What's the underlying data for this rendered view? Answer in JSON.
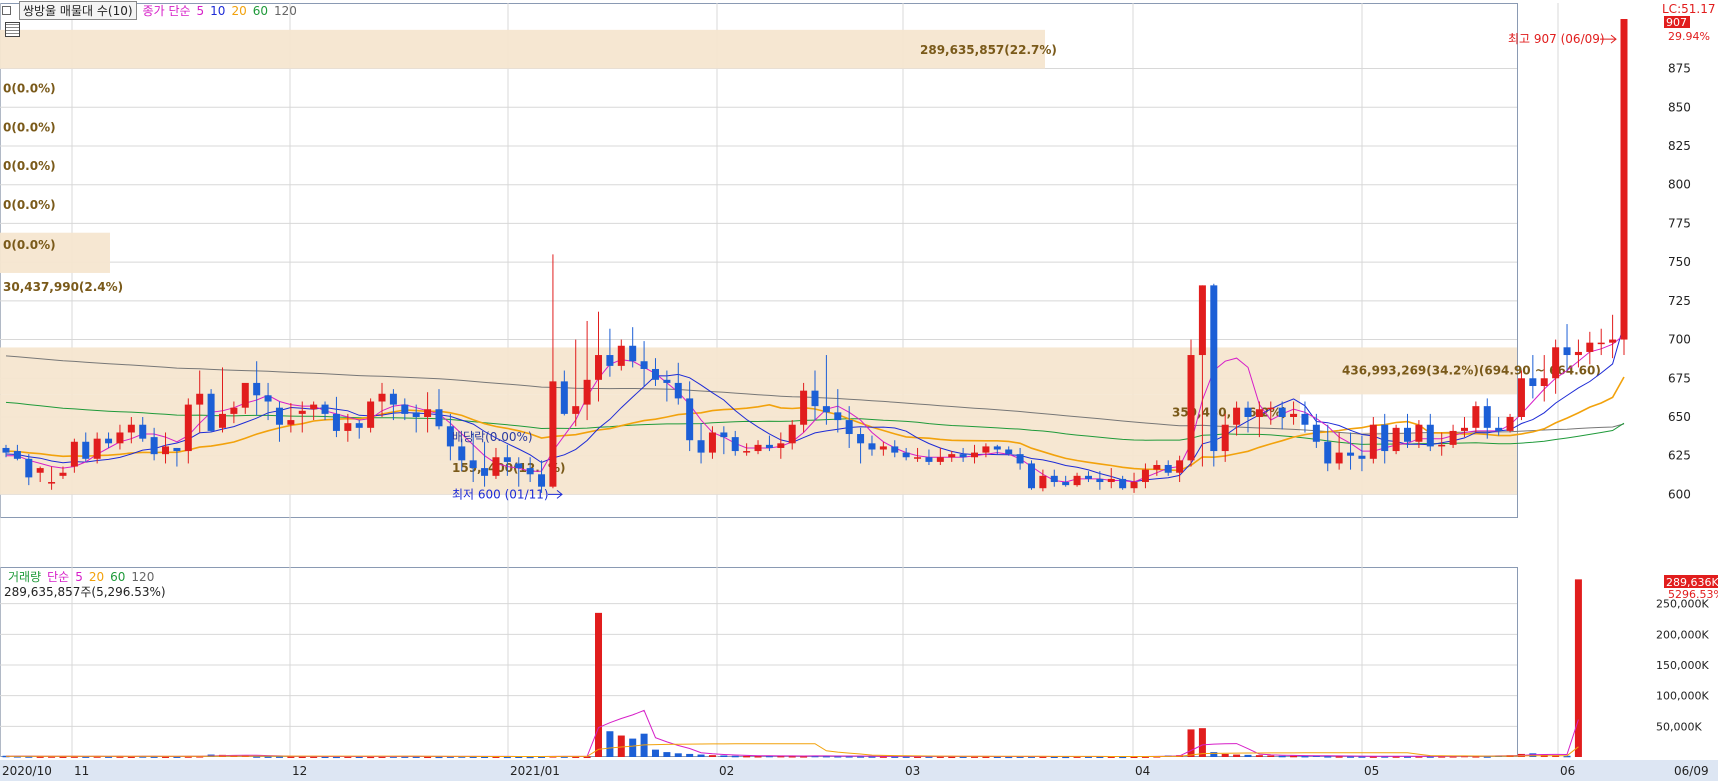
{
  "legend": {
    "title": "쌍방울 매물대 수(10)",
    "ma_label": "종가 단순",
    "ma": [
      {
        "label": "5",
        "color": "#d61fc8"
      },
      {
        "label": "10",
        "color": "#1d2bd6"
      },
      {
        "label": "20",
        "color": "#f2a20c"
      },
      {
        "label": "60",
        "color": "#1f9a3a"
      },
      {
        "label": "120",
        "color": "#666666"
      }
    ]
  },
  "header_right": {
    "lc": "LC:51.17",
    "price": "907",
    "pct": "29.94%"
  },
  "price_axis": {
    "ticks": [
      600,
      625,
      650,
      675,
      700,
      725,
      750,
      775,
      800,
      825,
      850,
      875
    ],
    "min": 588,
    "max": 907
  },
  "annotations": {
    "high": "최고 907 (06/09)",
    "low": "최저 600 (01/11)",
    "ex_div": "배당락(0.00%)"
  },
  "profile_labels": {
    "top": "289,635,857(22.7%)",
    "zero": "0(0.0%)",
    "mid_left": "30,437,990(2.4%)",
    "main": "436,993,269(34.2%)(694.90 ~ 664.60)",
    "lower": "359,430,",
    "lower_pct": "6.2%)",
    "bottom": "159,",
    "bottom_b": "400(12.",
    "bottom_c": "%)"
  },
  "volume": {
    "legend_label": "거래량",
    "ma_label": "단순",
    "ma": [
      {
        "label": "5",
        "color": "#d61fc8"
      },
      {
        "label": "20",
        "color": "#f2a20c"
      },
      {
        "label": "60",
        "color": "#1f9a3a"
      },
      {
        "label": "120",
        "color": "#666666"
      }
    ],
    "summary": "289,635,857주(5,296.53%)",
    "axis_ticks": [
      "50,000K",
      "100,000K",
      "150,000K",
      "200,000K",
      "250,000K"
    ],
    "last_label": "289,636K",
    "last_pct": "5296.53%"
  },
  "date_axis": [
    "2020/10",
    "11",
    "12",
    "2021/01",
    "02",
    "03",
    "04",
    "05",
    "06",
    "06/09"
  ],
  "colors": {
    "up": "#e11d1d",
    "down": "#1c5fd6",
    "band": "#f6e6d0",
    "band_text": "#7a5a1a",
    "grid": "#d8d8d8"
  },
  "chart_data": {
    "type": "candlestick",
    "xlabel": "",
    "ylabel": "",
    "ylim": [
      588,
      907
    ],
    "dates": [
      "2020/10",
      "11",
      "12",
      "2021/01",
      "02",
      "03",
      "04",
      "05",
      "06",
      "06/09"
    ],
    "candles_ohlc": [
      [
        630,
        632,
        624,
        627
      ],
      [
        628,
        632,
        622,
        623
      ],
      [
        623,
        626,
        606,
        611
      ],
      [
        614,
        618,
        608,
        617
      ],
      [
        607,
        618,
        603,
        608
      ],
      [
        612,
        618,
        610,
        614
      ],
      [
        618,
        636,
        614,
        634
      ],
      [
        634,
        640,
        621,
        623
      ],
      [
        623,
        640,
        620,
        636
      ],
      [
        636,
        640,
        630,
        633
      ],
      [
        633,
        645,
        629,
        640
      ],
      [
        640,
        650,
        633,
        645
      ],
      [
        645,
        650,
        634,
        636
      ],
      [
        637,
        643,
        622,
        626
      ],
      [
        626,
        640,
        620,
        631
      ],
      [
        630,
        630,
        618,
        628
      ],
      [
        628,
        662,
        620,
        658
      ],
      [
        658,
        680,
        640,
        665
      ],
      [
        665,
        668,
        640,
        641
      ],
      [
        643,
        682,
        640,
        652
      ],
      [
        652,
        660,
        646,
        656
      ],
      [
        656,
        668,
        652,
        672
      ],
      [
        672,
        686,
        651,
        664
      ],
      [
        664,
        672,
        648,
        660
      ],
      [
        656,
        660,
        634,
        645
      ],
      [
        645,
        659,
        640,
        648
      ],
      [
        652,
        660,
        640,
        654
      ],
      [
        655,
        660,
        648,
        658
      ],
      [
        658,
        660,
        648,
        652
      ],
      [
        652,
        663,
        637,
        641
      ],
      [
        641,
        652,
        634,
        646
      ],
      [
        646,
        648,
        636,
        643
      ],
      [
        643,
        662,
        640,
        660
      ],
      [
        660,
        672,
        650,
        665
      ],
      [
        665,
        668,
        648,
        658
      ],
      [
        658,
        662,
        648,
        652
      ],
      [
        653,
        658,
        640,
        650
      ],
      [
        650,
        666,
        640,
        655
      ],
      [
        655,
        668,
        642,
        644
      ],
      [
        644,
        652,
        622,
        631
      ],
      [
        631,
        636,
        615,
        622
      ],
      [
        622,
        640,
        608,
        617
      ],
      [
        617,
        634,
        605,
        612
      ],
      [
        612,
        630,
        610,
        624
      ],
      [
        624,
        632,
        612,
        621
      ],
      [
        620,
        624,
        605,
        617
      ],
      [
        617,
        624,
        608,
        613
      ],
      [
        613,
        622,
        601,
        605
      ],
      [
        605,
        755,
        604,
        673
      ],
      [
        673,
        680,
        651,
        652
      ],
      [
        652,
        700,
        644,
        657
      ],
      [
        658,
        712,
        648,
        674
      ],
      [
        674,
        718,
        660,
        690
      ],
      [
        690,
        707,
        676,
        683
      ],
      [
        683,
        700,
        680,
        696
      ],
      [
        696,
        708,
        682,
        686
      ],
      [
        686,
        699,
        670,
        681
      ],
      [
        681,
        688,
        670,
        674
      ],
      [
        674,
        680,
        660,
        672
      ],
      [
        672,
        685,
        658,
        662
      ],
      [
        662,
        673,
        628,
        635
      ],
      [
        635,
        646,
        620,
        627
      ],
      [
        627,
        644,
        623,
        640
      ],
      [
        640,
        644,
        626,
        637
      ],
      [
        637,
        641,
        625,
        628
      ],
      [
        628,
        633,
        625,
        628
      ],
      [
        628,
        635,
        626,
        632
      ],
      [
        632,
        638,
        628,
        630
      ],
      [
        630,
        640,
        623,
        633
      ],
      [
        633,
        648,
        629,
        645
      ],
      [
        645,
        672,
        640,
        667
      ],
      [
        667,
        680,
        648,
        657
      ],
      [
        657,
        690,
        645,
        653
      ],
      [
        653,
        668,
        640,
        648
      ],
      [
        648,
        657,
        630,
        639
      ],
      [
        639,
        643,
        620,
        633
      ],
      [
        633,
        638,
        625,
        629
      ],
      [
        629,
        634,
        625,
        631
      ],
      [
        631,
        635,
        624,
        627
      ],
      [
        627,
        630,
        622,
        624
      ],
      [
        624,
        630,
        621,
        624
      ],
      [
        624,
        629,
        619,
        621
      ],
      [
        621,
        630,
        619,
        624
      ],
      [
        624,
        628,
        621,
        626
      ],
      [
        626,
        630,
        621,
        624
      ],
      [
        624,
        632,
        620,
        627
      ],
      [
        627,
        633,
        624,
        631
      ],
      [
        631,
        632,
        626,
        629
      ],
      [
        629,
        631,
        625,
        626
      ],
      [
        626,
        630,
        616,
        620
      ],
      [
        620,
        622,
        603,
        604
      ],
      [
        604,
        616,
        602,
        612
      ],
      [
        612,
        616,
        605,
        608
      ],
      [
        608,
        612,
        605,
        606
      ],
      [
        606,
        614,
        605,
        612
      ],
      [
        612,
        615,
        608,
        610
      ],
      [
        610,
        615,
        603,
        608
      ],
      [
        608,
        617,
        604,
        610
      ],
      [
        610,
        612,
        603,
        604
      ],
      [
        604,
        614,
        601,
        608
      ],
      [
        608,
        620,
        604,
        616
      ],
      [
        616,
        622,
        612,
        619
      ],
      [
        619,
        622,
        612,
        614
      ],
      [
        614,
        625,
        608,
        622
      ],
      [
        622,
        700,
        618,
        690
      ],
      [
        690,
        735,
        618,
        735
      ],
      [
        735,
        736,
        618,
        628
      ],
      [
        628,
        652,
        621,
        645
      ],
      [
        645,
        660,
        638,
        656
      ],
      [
        656,
        660,
        640,
        650
      ],
      [
        650,
        660,
        637,
        655
      ],
      [
        655,
        660,
        645,
        656
      ],
      [
        656,
        660,
        642,
        650
      ],
      [
        650,
        660,
        645,
        652
      ],
      [
        652,
        660,
        640,
        645
      ],
      [
        645,
        652,
        630,
        634
      ],
      [
        634,
        645,
        615,
        620
      ],
      [
        620,
        640,
        616,
        627
      ],
      [
        627,
        640,
        616,
        625
      ],
      [
        625,
        638,
        615,
        623
      ],
      [
        623,
        650,
        620,
        645
      ],
      [
        645,
        652,
        620,
        628
      ],
      [
        628,
        645,
        626,
        643
      ],
      [
        643,
        652,
        630,
        634
      ],
      [
        634,
        648,
        630,
        645
      ],
      [
        645,
        652,
        628,
        631
      ],
      [
        631,
        640,
        625,
        632
      ],
      [
        632,
        645,
        630,
        641
      ],
      [
        641,
        650,
        637,
        643
      ],
      [
        643,
        660,
        640,
        657
      ],
      [
        657,
        662,
        636,
        643
      ],
      [
        643,
        650,
        638,
        641
      ],
      [
        641,
        652,
        640,
        650
      ],
      [
        650,
        680,
        648,
        675
      ],
      [
        675,
        690,
        662,
        670
      ],
      [
        670,
        690,
        660,
        675
      ],
      [
        675,
        700,
        665,
        695
      ],
      [
        695,
        710,
        680,
        690
      ],
      [
        690,
        700,
        682,
        692
      ],
      [
        692,
        705,
        684,
        698
      ],
      [
        698,
        707,
        690,
        698
      ],
      [
        698,
        716,
        688,
        700
      ],
      [
        700,
        907,
        690,
        907
      ]
    ],
    "ma5": [
      625,
      625,
      622,
      620,
      618,
      617,
      618,
      621,
      626,
      630,
      634,
      636,
      639,
      639,
      637,
      634,
      638,
      646,
      653,
      654,
      656,
      659,
      661,
      664,
      660,
      658,
      657,
      657,
      654,
      652,
      650,
      648,
      649,
      654,
      657,
      658,
      656,
      654,
      652,
      646,
      639,
      632,
      625,
      620,
      618,
      617,
      615,
      615,
      628,
      638,
      648,
      663,
      675,
      684,
      687,
      686,
      682,
      678,
      672,
      666,
      658,
      648,
      640,
      637,
      633,
      630,
      630,
      630,
      631,
      634,
      640,
      648,
      655,
      657,
      653,
      648,
      640,
      634,
      630,
      627,
      625,
      624,
      624,
      624,
      624,
      625,
      626,
      627,
      626,
      623,
      618,
      613,
      609,
      608,
      610,
      610,
      610,
      609,
      609,
      608,
      611,
      614,
      617,
      618,
      633,
      661,
      680,
      686,
      688,
      682,
      658,
      648,
      652,
      655,
      653,
      649,
      644,
      637,
      633,
      628,
      628,
      630,
      632,
      633,
      636,
      636,
      636,
      638,
      640,
      641,
      641,
      641,
      645,
      652,
      660,
      668,
      675,
      680,
      686,
      692,
      694,
      697,
      703
    ],
    "volume_k": [
      2000,
      1500,
      1200,
      1000,
      1200,
      900,
      1100,
      1000,
      1200,
      1000,
      1100,
      900,
      1300,
      1000,
      900,
      900,
      1200,
      1500,
      4000,
      3500,
      3000,
      2500,
      1200,
      1000,
      1000,
      900,
      800,
      900,
      800,
      700,
      900,
      800,
      700,
      900,
      1100,
      1000,
      900,
      800,
      700,
      1000,
      1200,
      900,
      800,
      900,
      700,
      800,
      600,
      900,
      1500,
      1100,
      900,
      800,
      235000,
      42000,
      35000,
      30000,
      38000,
      12000,
      8000,
      6000,
      5000,
      4000,
      3000,
      2500,
      2000,
      1800,
      1600,
      2000,
      1800,
      1600,
      1500,
      2000,
      1800,
      1600,
      1500,
      1300,
      1200,
      1100,
      1000,
      1000,
      900,
      1000,
      900,
      800,
      900,
      1000,
      900,
      800,
      700,
      900,
      1000,
      900,
      800,
      700,
      1000,
      900,
      800,
      900,
      700,
      800,
      1000,
      1500,
      2500,
      3000,
      45000,
      47000,
      8000,
      5000,
      4000,
      3500,
      3000,
      2500,
      2000,
      2000,
      1800,
      2500,
      1500,
      1300,
      1200,
      1200,
      1100,
      1300,
      1200,
      1100,
      1300,
      1200,
      1400,
      1500,
      2000,
      1500,
      1200,
      2500,
      3000,
      5000,
      6000,
      4000,
      3000,
      2000,
      289636
    ]
  }
}
